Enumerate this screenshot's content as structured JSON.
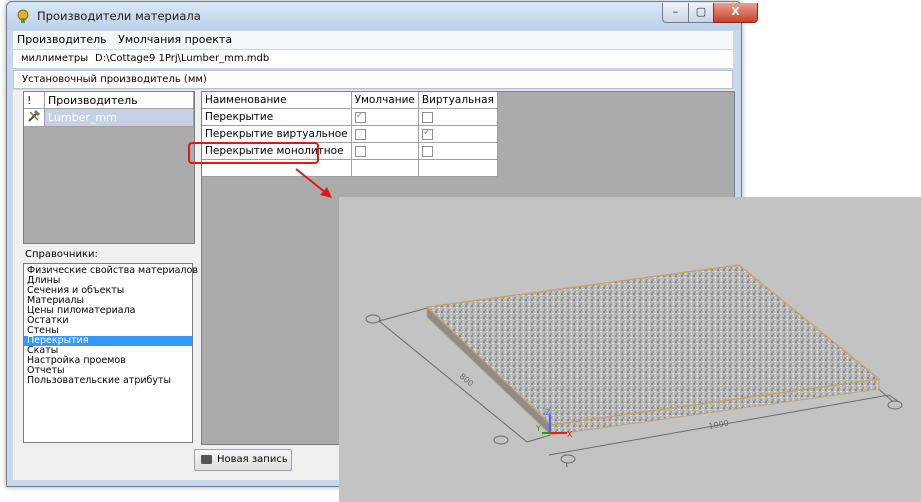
{
  "window": {
    "title": "Производители материала",
    "controls": {
      "minimize": "–",
      "maximize": "▢",
      "close": "X"
    }
  },
  "menu": [
    "Производитель",
    "Умолчания проекта"
  ],
  "pathbar": {
    "units": "миллиметры",
    "path": "D:\\Cottage9 1Prj\\Lumber_mm.mdb"
  },
  "manufacturer_setting": "Установочный производитель (мм)",
  "producers": {
    "headers": [
      "!",
      "Производитель"
    ],
    "rows": [
      {
        "icon": "tools-icon",
        "name": "Lumber_mm",
        "selected": true
      }
    ]
  },
  "references": {
    "label": "Справочники:",
    "items": [
      "Физические свойства материалов",
      "Длины",
      "Сечения и объекты",
      "Материалы",
      "Цены пиломатериала",
      "Остатки",
      "Стены",
      "Перекрытия",
      "Скаты",
      "Настройка проемов",
      "Отчеты",
      "Пользовательские атрибуты"
    ],
    "selected": "Перекрытия"
  },
  "materials": {
    "headers": [
      "Наименование",
      "Умолчание",
      "Виртуальная"
    ],
    "rows": [
      {
        "name": "Перекрытие",
        "default": true,
        "virtual": false
      },
      {
        "name": "Перекрытие виртуальное",
        "default": false,
        "virtual": true
      },
      {
        "name": "Перекрытие монолитное",
        "default": false,
        "virtual": false
      }
    ]
  },
  "new_record_label": "Новая запись",
  "preview": {
    "background": "#c3c3c3",
    "slab_edge_color": "#c8a060",
    "dimension_width": "1000",
    "dimension_depth": "800",
    "axes": [
      "X",
      "Y",
      "Z"
    ]
  },
  "colors": {
    "highlight": "#e01717",
    "selection": "#3399ff"
  }
}
